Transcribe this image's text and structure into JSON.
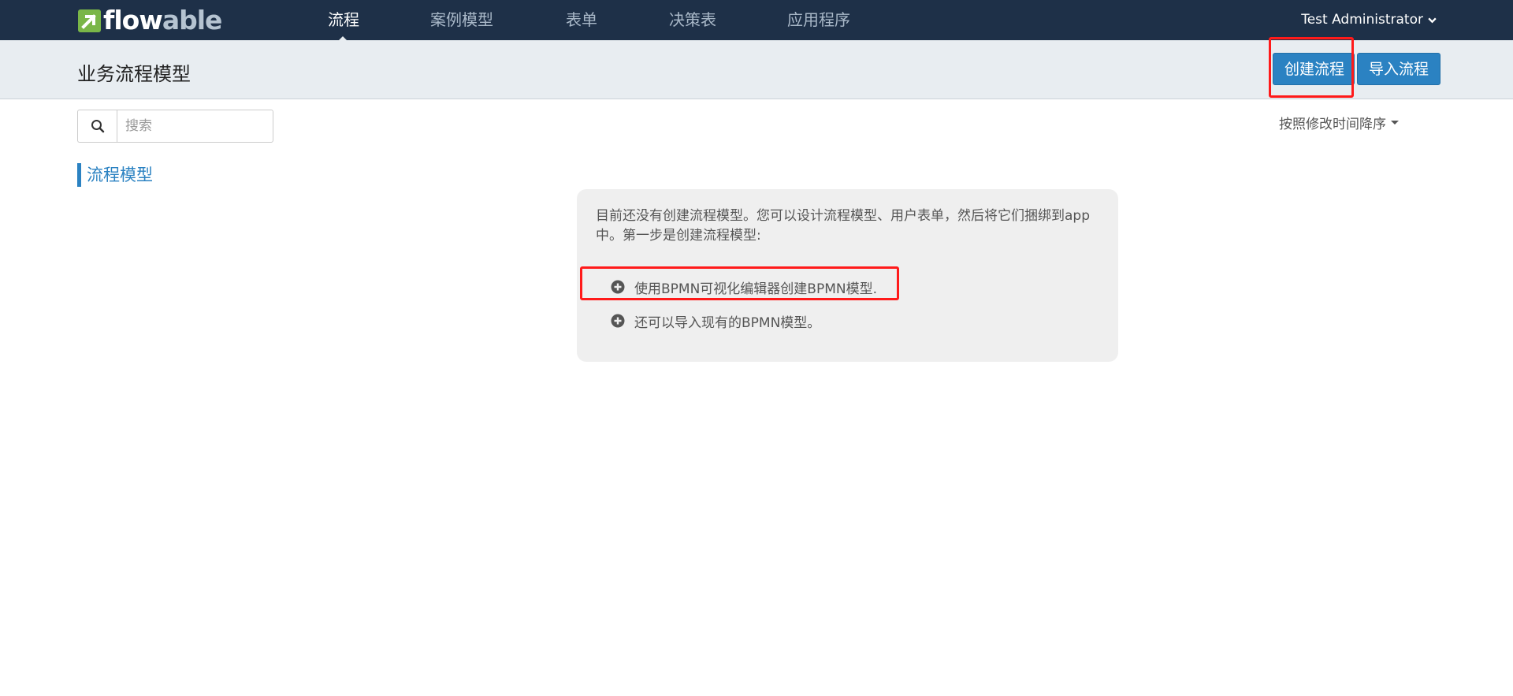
{
  "navbar": {
    "logo_main": "flow",
    "logo_accent": "able",
    "items": [
      {
        "label": "流程",
        "active": true
      },
      {
        "label": "案例模型",
        "active": false
      },
      {
        "label": "表单",
        "active": false
      },
      {
        "label": "决策表",
        "active": false
      },
      {
        "label": "应用程序",
        "active": false
      }
    ],
    "user": "Test Administrator"
  },
  "subheader": {
    "title": "业务流程模型",
    "create_button": "创建流程",
    "import_button": "导入流程"
  },
  "search": {
    "placeholder": "搜索",
    "value": ""
  },
  "sort_label": "按照修改时间降序",
  "section_label": "流程模型",
  "empty_state": {
    "message": "目前还没有创建流程模型。您可以设计流程模型、用户表单，然后将它们捆绑到app中。第一步是创建流程模型:",
    "action_create": "使用BPMN可视化编辑器创建BPMN模型.",
    "action_import": "还可以导入现有的BPMN模型。"
  },
  "colors": {
    "navbar_bg": "#1e3048",
    "brand_green": "#7ab648",
    "primary_blue": "#2b82c2",
    "highlight_red": "#ff1a1a"
  },
  "icons": {
    "search": "search-icon",
    "user_menu": "chevron-down-icon",
    "action": "plus-circle-icon"
  }
}
